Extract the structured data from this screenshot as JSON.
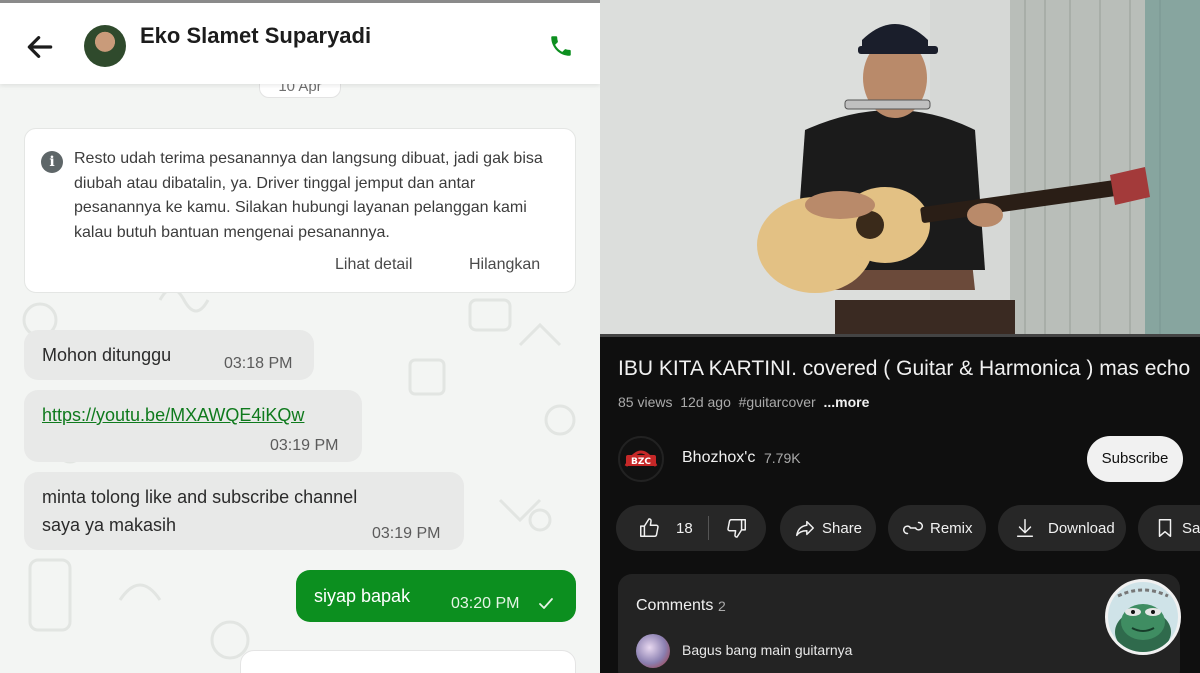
{
  "chat": {
    "contact_name": "Eko Slamet Suparyadi",
    "date_chip": "10 Apr",
    "info_text": "Resto udah terima pesanannya dan langsung dibuat, jadi gak bisa diubah atau dibatalin, ya. Driver tinggal jemput dan antar pesanannya ke kamu. Silakan hubungi layanan pelanggan kami kalau butuh bantuan mengenai pesanannya.",
    "info_actions": [
      "Lihat detail",
      "Hilangkan"
    ],
    "messages": [
      {
        "direction": "in",
        "text": "Mohon ditunggu",
        "time": "03:18 PM"
      },
      {
        "direction": "in",
        "text": "https://youtu.be/MXAWQE4iKQw",
        "time": "03:19 PM",
        "is_link": true
      },
      {
        "direction": "in",
        "text_lines": [
          "minta tolong like and subscribe channel",
          "saya ya makasih"
        ],
        "time": "03:19 PM"
      },
      {
        "direction": "out",
        "text": "siyap bapak",
        "time": "03:20 PM",
        "status": "sent"
      }
    ],
    "colors": {
      "outgoing_bubble": "#0c8f1f",
      "incoming_bubble": "#e8e9e8",
      "accent": "#0c8f1f"
    }
  },
  "youtube": {
    "title": "IBU KITA KARTINI. covered ( Guitar & Harmonica ) mas echo",
    "views": "85 views",
    "age": "12d ago",
    "hashtag": "#guitarcover",
    "more_label": "...more",
    "channel": {
      "name": "Bhozhox'c",
      "subscribers": "7.79K",
      "logo_text": "BZC"
    },
    "subscribe_label": "Subscribe",
    "actions": {
      "likes": "18",
      "share": "Share",
      "remix": "Remix",
      "download": "Download",
      "save": "Save"
    },
    "comments": {
      "title": "Comments",
      "count": "2",
      "top_comment": "Bagus bang main guitarnya"
    },
    "colors": {
      "background": "#0f0f0f",
      "pill": "#272727"
    }
  }
}
